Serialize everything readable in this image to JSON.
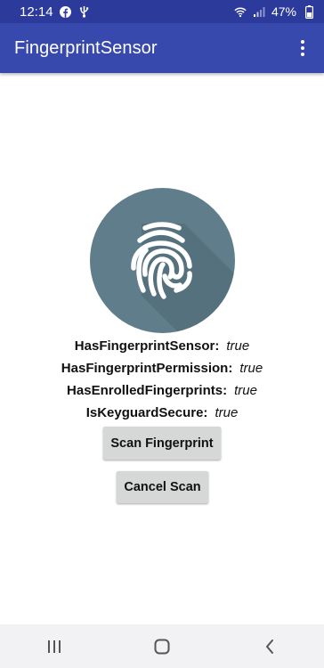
{
  "status_bar": {
    "time": "12:14",
    "battery": "47%",
    "left_icons": [
      "facebook-icon",
      "usb-icon"
    ],
    "right_icons": [
      "wifi-icon",
      "signal-icon"
    ]
  },
  "app_bar": {
    "title": "FingerprintSensor",
    "menu_icon": "more-vert-icon"
  },
  "fingerprint": {
    "icon": "fingerprint-icon",
    "circle_color": "#607d8b"
  },
  "info": [
    {
      "label": "HasFingerprintSensor:",
      "value": "true"
    },
    {
      "label": "HasFingerprintPermission:",
      "value": "true"
    },
    {
      "label": "HasEnrolledFingerprints:",
      "value": "true"
    },
    {
      "label": "IsKeyguardSecure:",
      "value": "true"
    }
  ],
  "buttons": {
    "scan": "Scan Fingerprint",
    "cancel": "Cancel Scan"
  },
  "nav_bar": {
    "icons": [
      "recents-icon",
      "home-icon",
      "back-icon"
    ]
  },
  "colors": {
    "status_bar": "#2c3a9c",
    "app_bar": "#3849ad",
    "button": "#d6d7d7"
  }
}
